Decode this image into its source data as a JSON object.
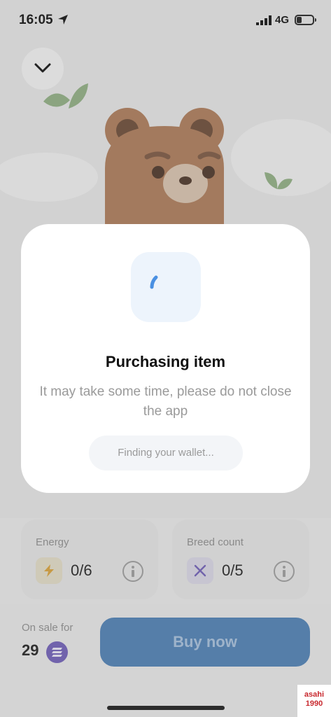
{
  "status_bar": {
    "time": "16:05",
    "network": "4G",
    "icons": [
      "location-arrow-icon",
      "signal-icon",
      "battery-icon"
    ]
  },
  "background": {
    "collapse_icon": "chevron-down-icon"
  },
  "modal": {
    "title": "Purchasing item",
    "description": "It may take some time, please do not close the app",
    "status": "Finding your wallet...",
    "spinner_icon": "loading-spinner-icon"
  },
  "stats": {
    "energy": {
      "label": "Energy",
      "value": "0/6",
      "icon": "lightning-icon"
    },
    "breed": {
      "label": "Breed count",
      "value": "0/5",
      "icon": "dna-icon"
    }
  },
  "sale": {
    "label": "On sale for",
    "price": "29",
    "currency_icon": "solana-coin-icon",
    "buy_label": "Buy now"
  },
  "watermark": {
    "line1": "asahi",
    "line2": "1990"
  },
  "colors": {
    "accent": "#4d7fb4",
    "spinner": "#4a90e2",
    "coin": "#6f5fb8"
  }
}
